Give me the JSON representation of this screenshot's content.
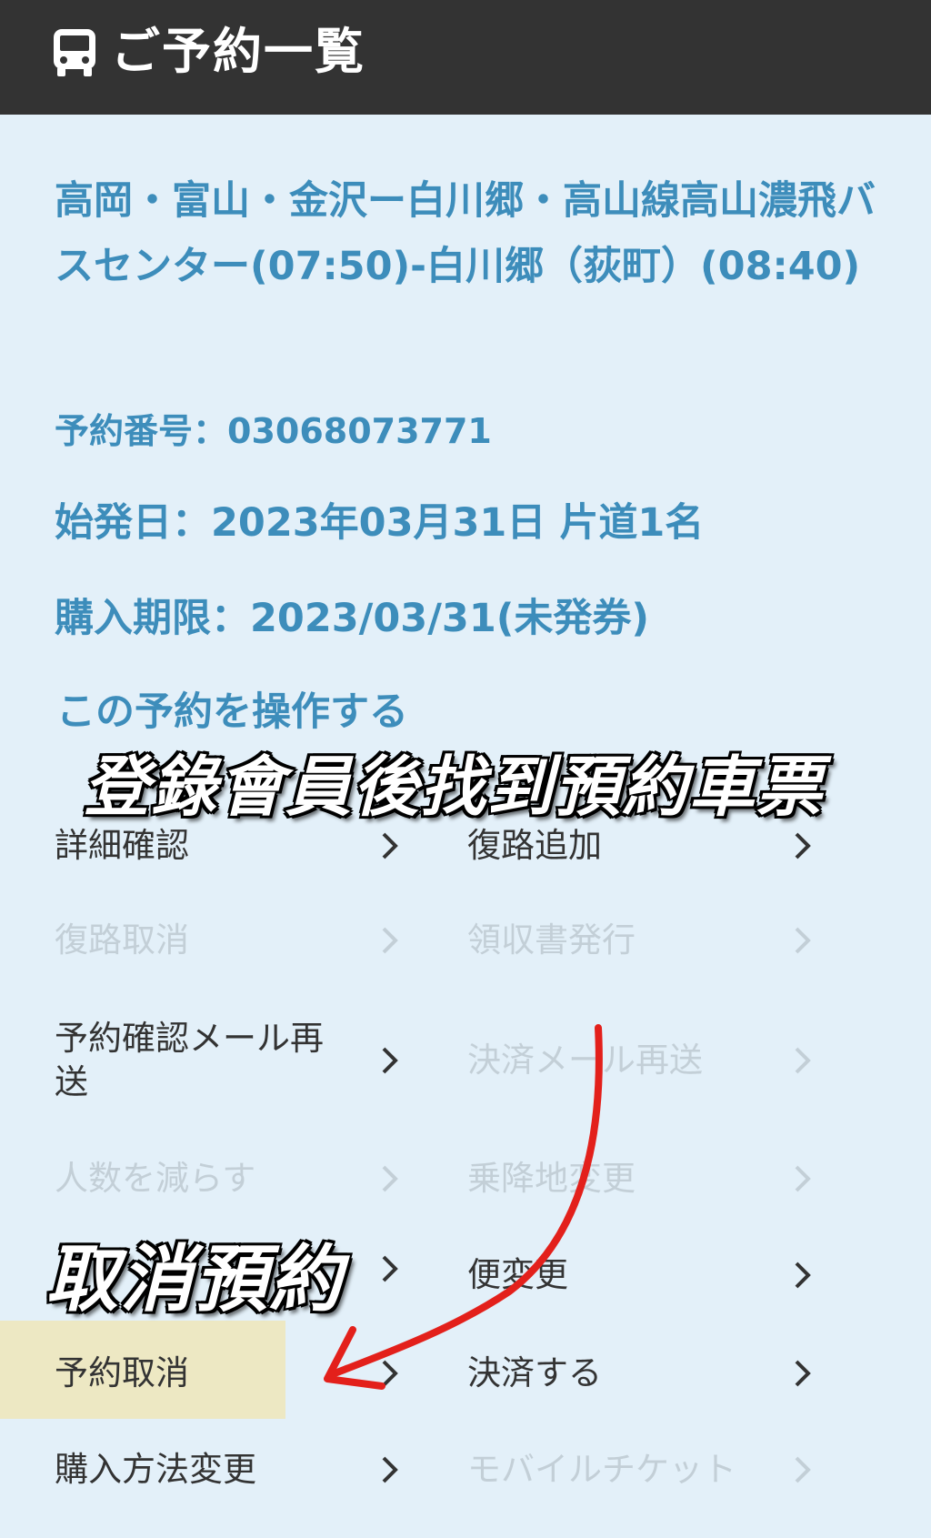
{
  "header": {
    "title": "ご予約一覧",
    "icon": "bus-icon"
  },
  "reservation": {
    "route": "高岡・富山・金沢ー白川郷・高山線高山濃飛バスセンター(07:50)-白川郷（荻町）(08:40)",
    "reservation_number": "予約番号：03068073771",
    "departure_date": "始発日：2023年03月31日 片道1名",
    "purchase_deadline": "購入期限：2023/03/31(未発券)"
  },
  "actions_title": "この予約を操作する",
  "menu": {
    "detail": "詳細確認",
    "add_return": "復路追加",
    "cancel_return": "復路取消",
    "receipt": "領収書発行",
    "resend_confirm_mail": "予約確認メール再送",
    "resend_payment_mail": "決済メール再送",
    "reduce_people": "人数を減らす",
    "change_stops": "乗降地変更",
    "hidden_item": "",
    "change_trip": "便変更",
    "cancel_reservation": "予約取消",
    "pay": "決済する",
    "change_purchase_method": "購入方法変更",
    "mobile_ticket": "モバイルチケット"
  },
  "overlay": {
    "caption_1": "登錄會員後找到預約車票",
    "caption_2": "取消預約"
  },
  "colors": {
    "header_bg": "#333333",
    "page_bg": "#e3f0f9",
    "accent_blue": "#3d8dbb",
    "disabled": "#c3cfd7",
    "highlight": "#ede7bd",
    "arrow_red": "#e3201b"
  }
}
